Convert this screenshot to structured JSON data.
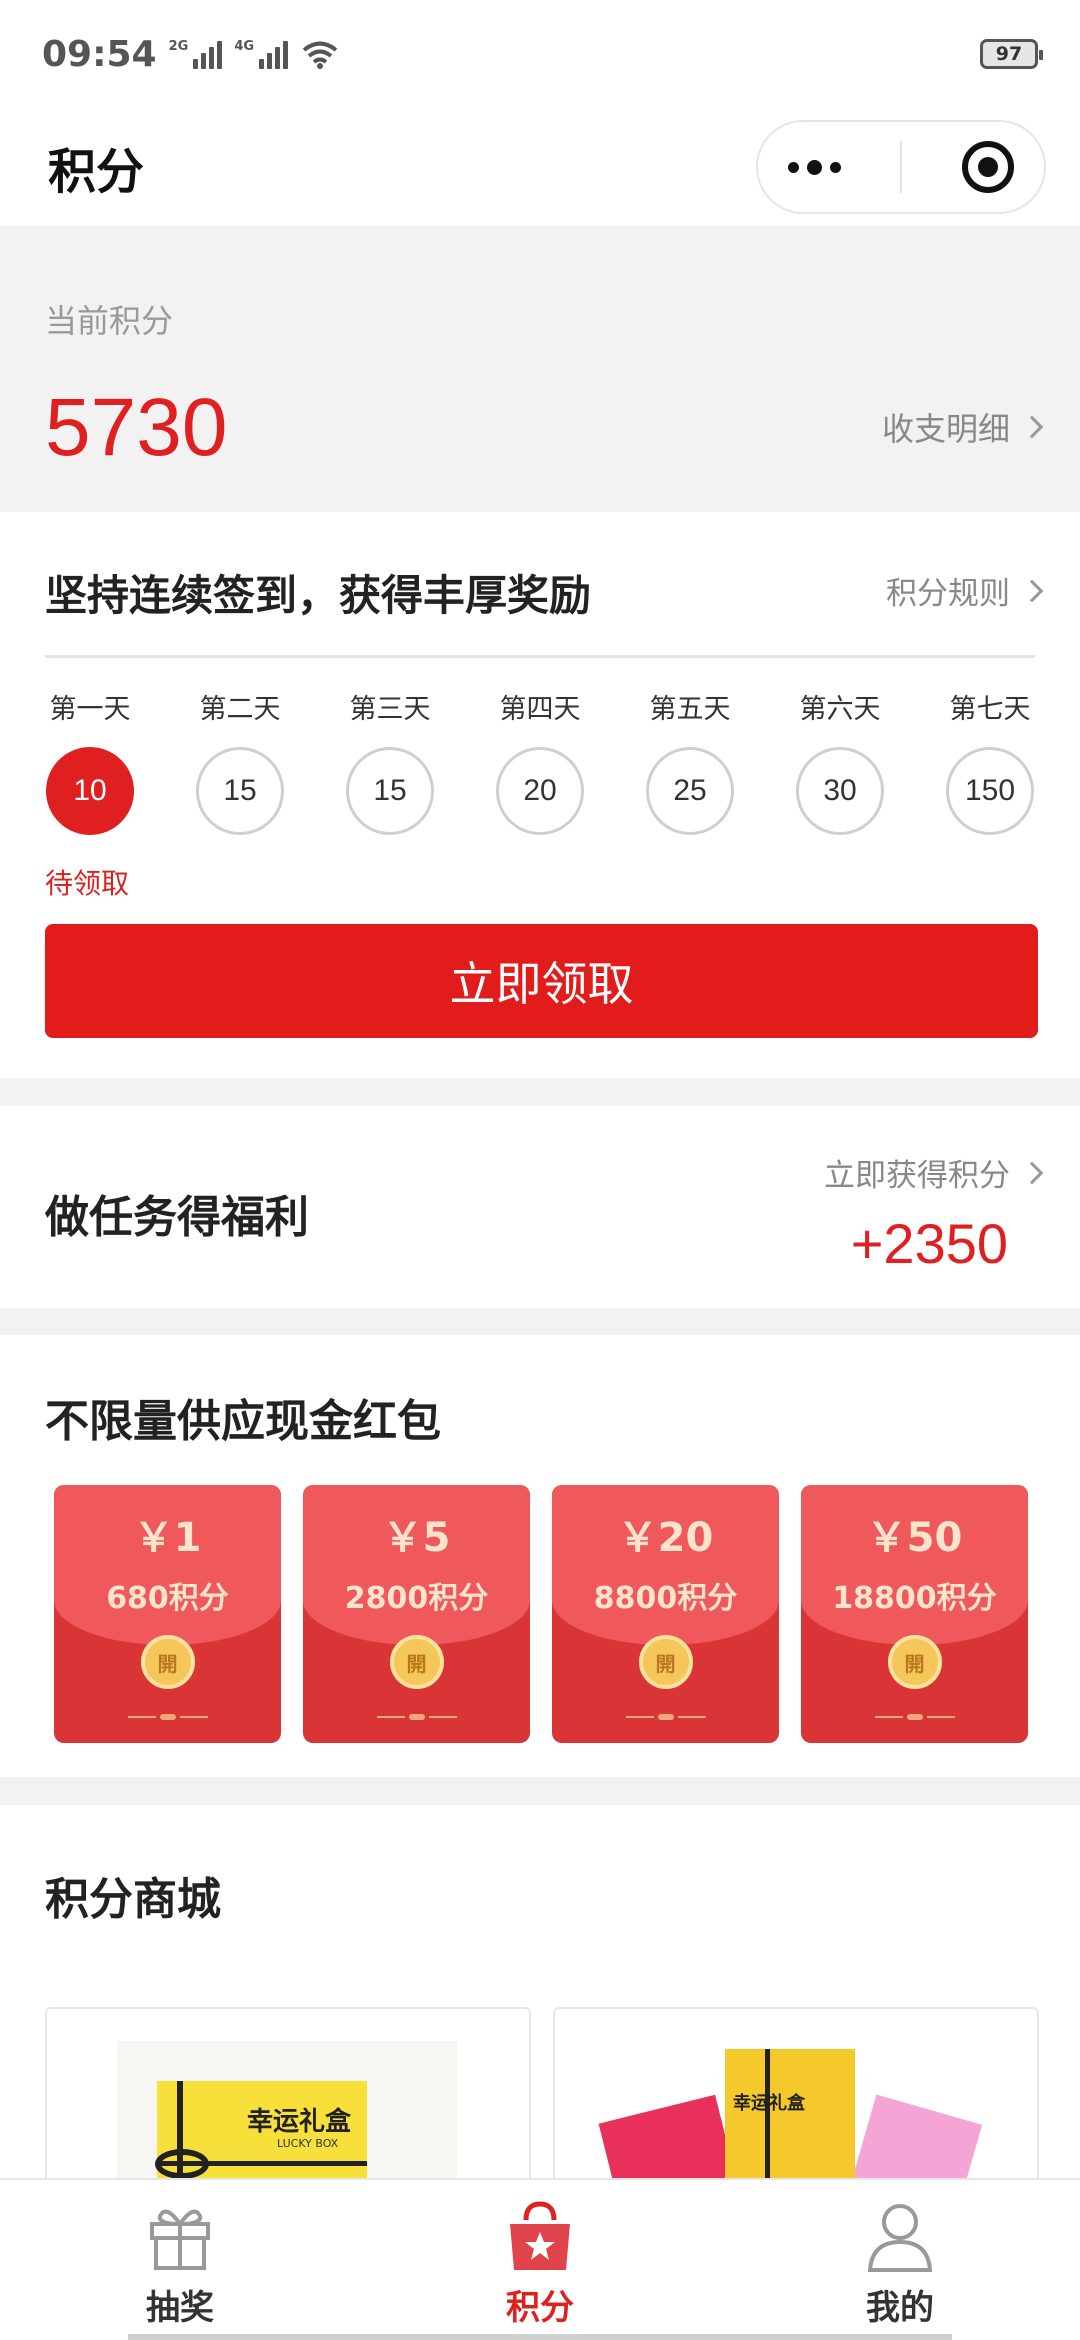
{
  "status_bar": {
    "time": "09:54",
    "net1": "2G",
    "net2": "4G",
    "battery": "97"
  },
  "nav": {
    "title": "积分"
  },
  "points": {
    "label": "当前积分",
    "value": "5730",
    "detail_link": "收支明细"
  },
  "checkin": {
    "title": "坚持连续签到，获得丰厚奖励",
    "rules_link": "积分规则",
    "days": [
      {
        "label": "第一天",
        "points": "10",
        "active": true
      },
      {
        "label": "第二天",
        "points": "15"
      },
      {
        "label": "第三天",
        "points": "15"
      },
      {
        "label": "第四天",
        "points": "20"
      },
      {
        "label": "第五天",
        "points": "25"
      },
      {
        "label": "第六天",
        "points": "30"
      },
      {
        "label": "第七天",
        "points": "150"
      }
    ],
    "pending": "待领取",
    "claim_button": "立即领取"
  },
  "tasks": {
    "title": "做任务得福利",
    "link": "立即获得积分",
    "bonus": "+2350"
  },
  "packets": {
    "title": "不限量供应现金红包",
    "items": [
      {
        "amount": "￥1",
        "points": "680积分",
        "coin": "開"
      },
      {
        "amount": "￥5",
        "points": "2800积分",
        "coin": "開"
      },
      {
        "amount": "￥20",
        "points": "8800积分",
        "coin": "開"
      },
      {
        "amount": "￥50",
        "points": "18800积分",
        "coin": "開"
      }
    ]
  },
  "mall": {
    "title": "积分商城",
    "products": [
      {
        "box_text": "幸运礼盒",
        "box_sub": "LUCKY BOX"
      },
      {
        "box_text": "幸运礼盒"
      }
    ]
  },
  "tabbar": {
    "items": [
      {
        "label": "抽奖",
        "icon": "gift-icon"
      },
      {
        "label": "积分",
        "icon": "points-bag-icon",
        "active": true
      },
      {
        "label": "我的",
        "icon": "user-icon"
      }
    ]
  },
  "colors": {
    "accent": "#e02020",
    "packet_top": "#f0595b",
    "packet_bottom": "#d93436"
  }
}
